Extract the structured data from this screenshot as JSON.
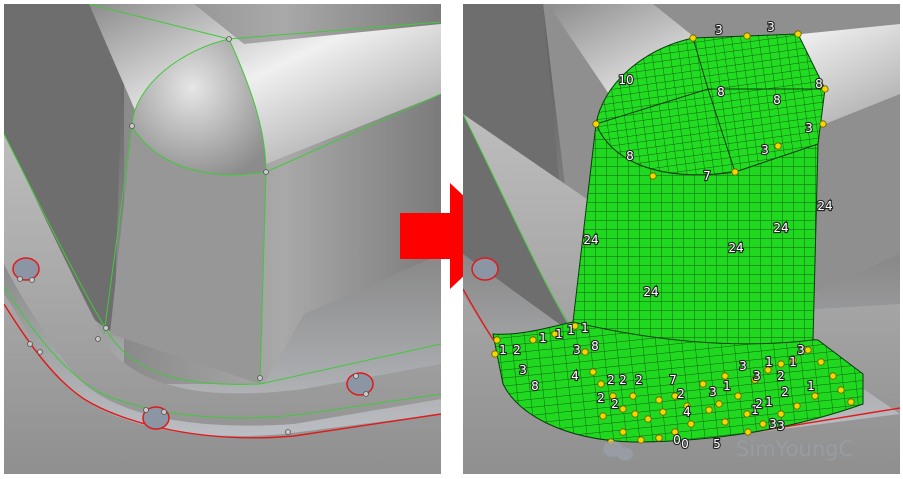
{
  "panels": {
    "before": {
      "label": ""
    },
    "after": {
      "label": ""
    }
  },
  "arrow": {
    "color": "#ff0000"
  },
  "colors": {
    "mesh_fill": "#1fd81f",
    "mesh_lines": "#0b3a0b",
    "surface_edges": "#42c83a",
    "free_edges": "#e01a1a",
    "vertices": "#f2d600",
    "background_top": "#5e5e5e",
    "background_bottom": "#b8bcc4"
  },
  "edge_counts": {
    "top": [
      "3",
      "3",
      "10",
      "8",
      "8",
      "8",
      "3",
      "3",
      "8",
      "7"
    ],
    "walls": [
      "24",
      "24",
      "24",
      "24",
      "24"
    ],
    "flange": [
      "1",
      "2",
      "1",
      "1",
      "1",
      "1",
      "3",
      "8",
      "3",
      "8",
      "4",
      "2",
      "2",
      "2",
      "2",
      "2",
      "7",
      "2",
      "3",
      "1",
      "3",
      "3",
      "1",
      "2",
      "1",
      "3",
      "1",
      "2",
      "1",
      "1",
      "4",
      "5",
      "3",
      "3",
      "2",
      "0",
      "0"
    ]
  },
  "watermark": {
    "text": "SimYoungC",
    "icon": "wechat-logo-icon"
  }
}
